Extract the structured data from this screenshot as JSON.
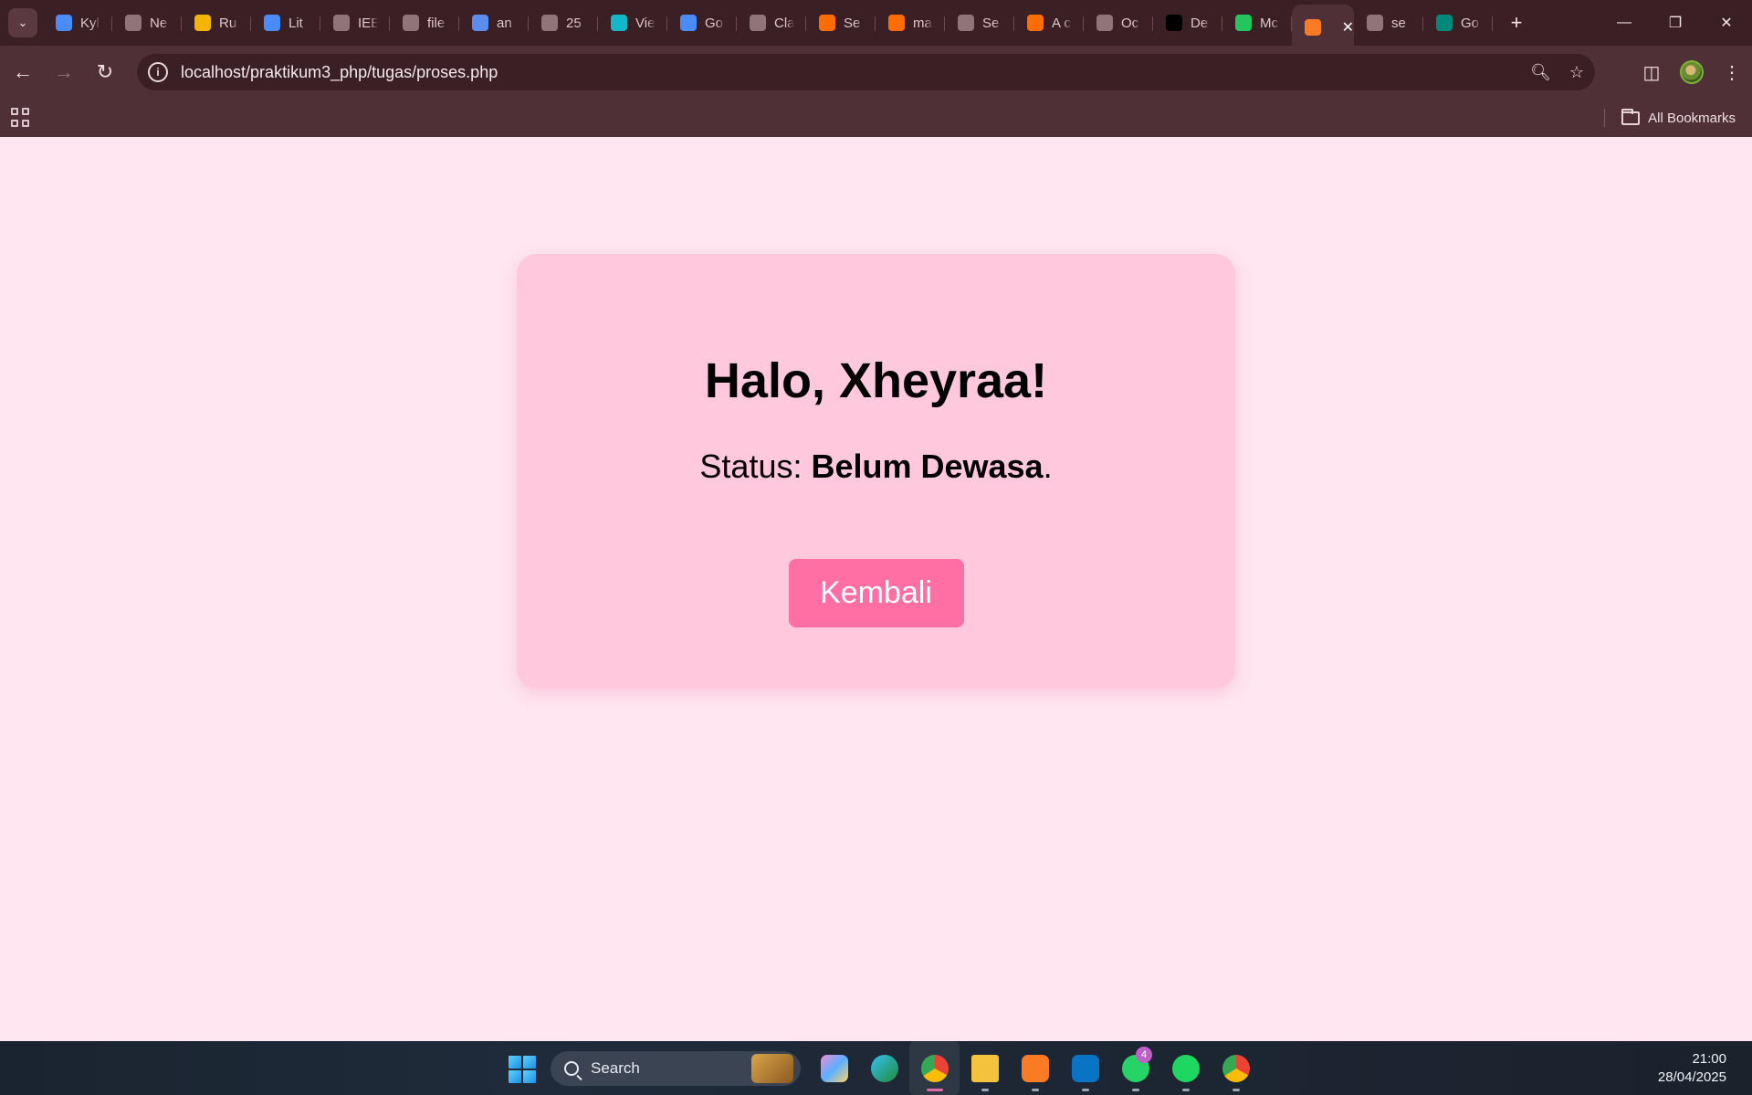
{
  "browser": {
    "tabs": [
      {
        "label": "Kyl",
        "icon": "docs-icon",
        "color": "#4a8cf7"
      },
      {
        "label": "Ne",
        "icon": "chrome-icon",
        "color": "#8f7479"
      },
      {
        "label": "Ru",
        "icon": "drive-icon",
        "color": "#f4b400"
      },
      {
        "label": "Lit",
        "icon": "docs-icon",
        "color": "#4a8cf7"
      },
      {
        "label": "IEE",
        "icon": "globe-icon",
        "color": "#8f7479"
      },
      {
        "label": "file",
        "icon": "globe-icon",
        "color": "#8f7479"
      },
      {
        "label": "an",
        "icon": "gemini-icon",
        "color": "#5b8def"
      },
      {
        "label": "25",
        "icon": "globe-icon",
        "color": "#8f7479"
      },
      {
        "label": "Vie",
        "icon": "canva-icon",
        "color": "#12b8c9"
      },
      {
        "label": "Go",
        "icon": "translate-icon",
        "color": "#4a8cf7"
      },
      {
        "label": "Cla",
        "icon": "globe-icon",
        "color": "#8f7479"
      },
      {
        "label": "Se",
        "icon": "elsevier-icon",
        "color": "#ff6c00"
      },
      {
        "label": "ma",
        "icon": "elsevier-icon",
        "color": "#ff6c00"
      },
      {
        "label": "Se",
        "icon": "globe-icon",
        "color": "#8f7479"
      },
      {
        "label": "A c",
        "icon": "elsevier-icon",
        "color": "#ff6c00"
      },
      {
        "label": "Oc",
        "icon": "globe-icon",
        "color": "#8f7479"
      },
      {
        "label": "De",
        "icon": "x-icon",
        "color": "#000000"
      },
      {
        "label": "Mc",
        "icon": "zotero-icon",
        "color": "#22c55e"
      },
      {
        "label": "",
        "icon": "xampp-icon",
        "color": "#fb7a24",
        "active": true
      },
      {
        "label": "se",
        "icon": "globe-icon",
        "color": "#8f7479"
      },
      {
        "label": "Go",
        "icon": "meet-icon",
        "color": "#00897b"
      }
    ],
    "url_host": "localhost",
    "url_path": "/praktikum3_php/tugas/proses.php",
    "bookmarks_label": "All Bookmarks"
  },
  "page": {
    "greeting": "Halo, Xheyraa!",
    "status_prefix": "Status: ",
    "status_value": "Belum Dewasa",
    "status_suffix": ".",
    "back_button": "Kembali"
  },
  "taskbar": {
    "search_label": "Search",
    "whatsapp_badge": "4",
    "time": "21:00",
    "date": "28/04/2025"
  },
  "colors": {
    "page_bg": "#ffe6f0",
    "card_bg": "#ffc8dd",
    "button_bg": "#ff6fa3"
  }
}
